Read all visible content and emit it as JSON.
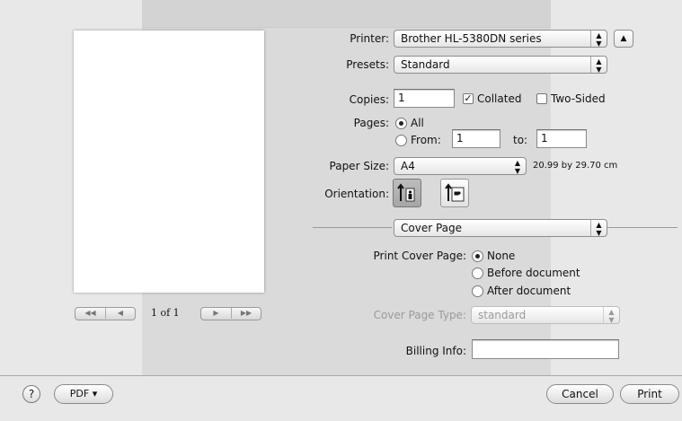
{
  "printer": {
    "label": "Printer:",
    "value": "Brother HL-5380DN series"
  },
  "presets": {
    "label": "Presets:",
    "value": "Standard"
  },
  "copies": {
    "label": "Copies:",
    "value": "1",
    "collated_label": "Collated",
    "collated_checked": true,
    "two_sided_label": "Two-Sided",
    "two_sided_checked": false
  },
  "pages": {
    "label": "Pages:",
    "all_label": "All",
    "from_label": "From:",
    "from_value": "1",
    "to_label": "to:",
    "to_value": "1"
  },
  "paper_size": {
    "label": "Paper Size:",
    "value": "A4",
    "dimensions": "20.99 by 29.70 cm"
  },
  "orientation": {
    "label": "Orientation:"
  },
  "section": {
    "value": "Cover Page"
  },
  "cover_page": {
    "label": "Print Cover Page:",
    "options": [
      "None",
      "Before document",
      "After document"
    ]
  },
  "cover_type": {
    "label": "Cover Page Type:",
    "value": "standard"
  },
  "billing": {
    "label": "Billing Info:",
    "value": ""
  },
  "preview": {
    "page_indicator": "1 of 1"
  },
  "buttons": {
    "help": "?",
    "pdf": "PDF ▾",
    "cancel": "Cancel",
    "print": "Print"
  }
}
